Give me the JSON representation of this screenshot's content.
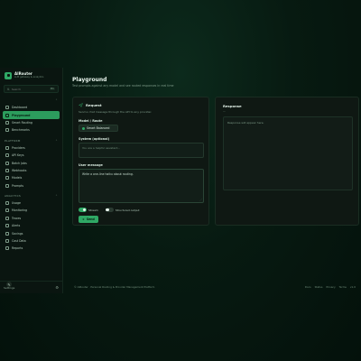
{
  "brand": {
    "name": "AIRouter",
    "subtitle": "LLM gateway & analytics"
  },
  "search": {
    "placeholder": "Search",
    "shortcut": "⌘K"
  },
  "sidebar": {
    "groups": [
      {
        "title": "",
        "items": [
          {
            "label": "Dashboard",
            "icon": "grid-icon",
            "active": false
          },
          {
            "label": "Playground",
            "icon": "play-icon",
            "active": true
          },
          {
            "label": "Smart Routing",
            "icon": "route-icon",
            "active": false
          },
          {
            "label": "Benchmarks",
            "icon": "chart-icon",
            "active": false
          }
        ]
      },
      {
        "title": "PLATFORM",
        "items": [
          {
            "label": "Providers",
            "icon": "server-icon",
            "active": false
          },
          {
            "label": "API Keys",
            "icon": "key-icon",
            "active": false
          },
          {
            "label": "Batch Jobs",
            "icon": "layers-icon",
            "active": false
          },
          {
            "label": "Webhooks",
            "icon": "link-icon",
            "active": false
          },
          {
            "label": "Models",
            "icon": "cube-icon",
            "active": false
          },
          {
            "label": "Prompts",
            "icon": "file-icon",
            "active": false
          }
        ]
      },
      {
        "title": "ANALYTICS",
        "items": [
          {
            "label": "Usage",
            "icon": "activity-icon",
            "active": false
          },
          {
            "label": "Monitoring",
            "icon": "monitor-icon",
            "active": false
          },
          {
            "label": "Traces",
            "icon": "trace-icon",
            "active": false
          },
          {
            "label": "Alerts",
            "icon": "bell-icon",
            "active": false
          },
          {
            "label": "Savings",
            "icon": "piggy-icon",
            "active": false
          },
          {
            "label": "Cost Data",
            "icon": "database-icon",
            "active": false
          },
          {
            "label": "Reports",
            "icon": "report-icon",
            "active": false
          }
        ]
      }
    ],
    "footer": {
      "label": "Settings"
    }
  },
  "main": {
    "title": "Playground",
    "subtitle": "Test prompts against any model and see routed responses in real time",
    "request": {
      "title": "Request",
      "description": "Send a chat message through the API to any provider.",
      "model_label": "Model / Route",
      "model_value": "Smart Balanced",
      "system_label": "System (optional)",
      "system_placeholder": "You are a helpful assistant...",
      "user_label": "User message",
      "user_value": "Write a one-line haiku about routing.",
      "toggle_stream": "Stream",
      "toggle_json": "Structured output",
      "send_label": "Send"
    },
    "response": {
      "title": "Response",
      "sub": "—",
      "placeholder": "Response will appear here."
    }
  },
  "footer": {
    "left": "© AIRouter · Personal Routing & Provider Management Platform",
    "links": [
      "Docs",
      "Status",
      "Privacy",
      "Terms",
      "v1.0"
    ]
  }
}
